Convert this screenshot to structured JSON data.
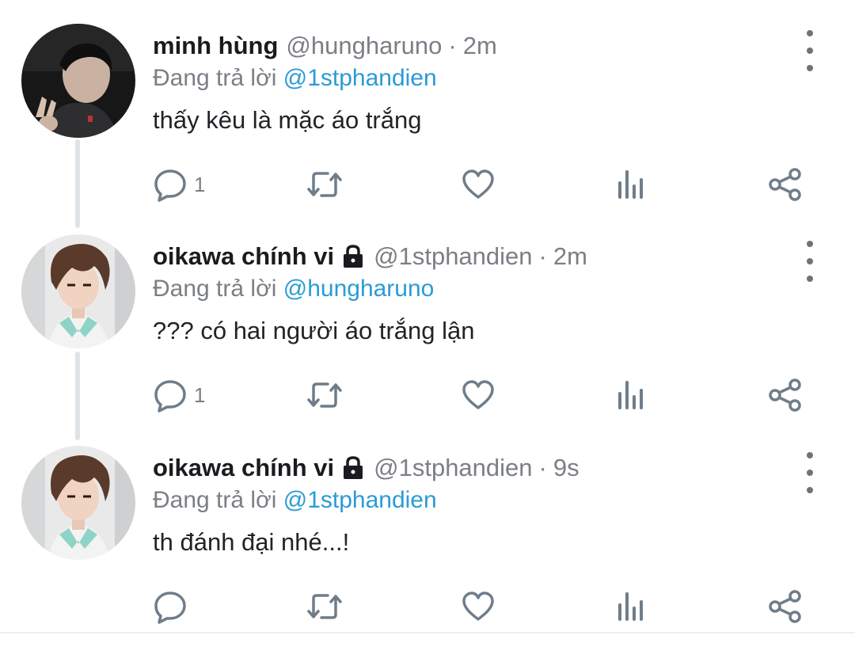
{
  "tweets": [
    {
      "name": "minh hùng",
      "handle": "@hungharuno",
      "separator": "·",
      "time": "2m",
      "reply_prefix": "Đang trả lời",
      "reply_to": "@1stphandien",
      "text": "thấy kêu là mặc áo trắng",
      "reply_count": "1",
      "locked": false
    },
    {
      "name": "oikawa chính vi",
      "handle": "@1stphandien",
      "separator": "·",
      "time": "2m",
      "reply_prefix": "Đang trả lời",
      "reply_to": "@hungharuno",
      "text": "??? có hai người áo trắng lận",
      "reply_count": "1",
      "locked": true
    },
    {
      "name": "oikawa chính vi",
      "handle": "@1stphandien",
      "separator": "·",
      "time": "9s",
      "reply_prefix": "Đang trả lời",
      "reply_to": "@1stphandien",
      "text": "th đánh đại nhé...!",
      "reply_count": "",
      "locked": true
    }
  ],
  "colors": {
    "link": "#2b9bd6",
    "muted": "#7b7f85",
    "icon": "#6f7d8a",
    "thread_line": "#dfe3e6"
  },
  "icons": [
    "more-vertical-icon",
    "reply-icon",
    "retweet-icon",
    "like-icon",
    "analytics-icon",
    "share-icon",
    "lock-icon"
  ]
}
